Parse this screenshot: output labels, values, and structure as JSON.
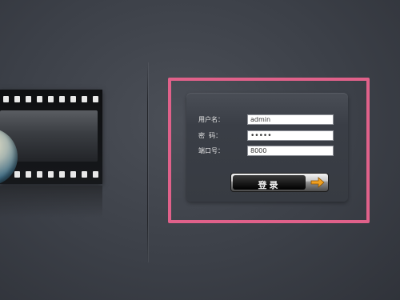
{
  "login": {
    "username_label": "用户名：",
    "username_value": "admin",
    "password_label": "密  码：",
    "password_value": "•••••",
    "port_label": "端口号：",
    "port_value": "8000",
    "login_button": "登录"
  },
  "colors": {
    "background": "#3c4048",
    "highlight_border": "#e0618a",
    "arrow": "#f0a020"
  },
  "icons": [
    "film-strip-icon",
    "globe-icon",
    "arrow-right-icon"
  ]
}
